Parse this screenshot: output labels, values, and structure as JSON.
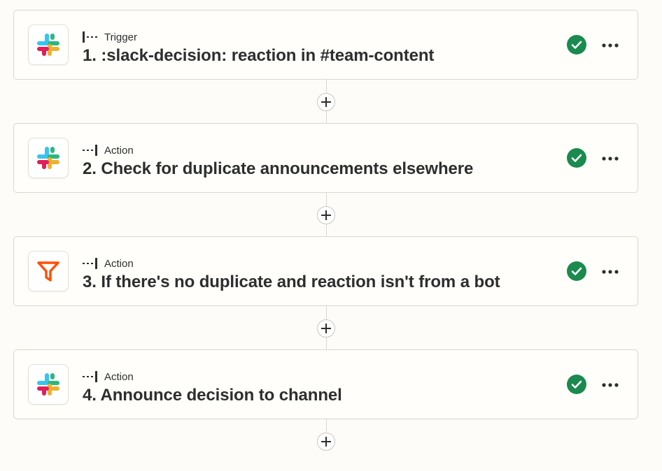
{
  "steps": [
    {
      "type_label": "Trigger",
      "title": "1. :slack-decision: reaction in #team-content",
      "app_icon": "slack-icon",
      "kind": "trigger",
      "status": "complete"
    },
    {
      "type_label": "Action",
      "title": "2. Check for duplicate announcements elsewhere",
      "app_icon": "slack-icon",
      "kind": "action",
      "status": "complete"
    },
    {
      "type_label": "Action",
      "title": "3. If there's no duplicate and reaction isn't from a bot",
      "app_icon": "filter-icon",
      "kind": "action",
      "status": "complete"
    },
    {
      "type_label": "Action",
      "title": "4. Announce decision to channel",
      "app_icon": "slack-icon",
      "kind": "action",
      "status": "complete"
    }
  ],
  "colors": {
    "status_green": "#1a8a4e",
    "filter_orange": "#ff4f00",
    "slack_blue": "#36c5f0",
    "slack_green": "#2eb67d",
    "slack_red": "#e01e5a",
    "slack_yellow": "#ecb22e"
  },
  "icons": {
    "more": "more-dots-icon",
    "add": "plus-icon",
    "status": "check-circle-icon"
  }
}
